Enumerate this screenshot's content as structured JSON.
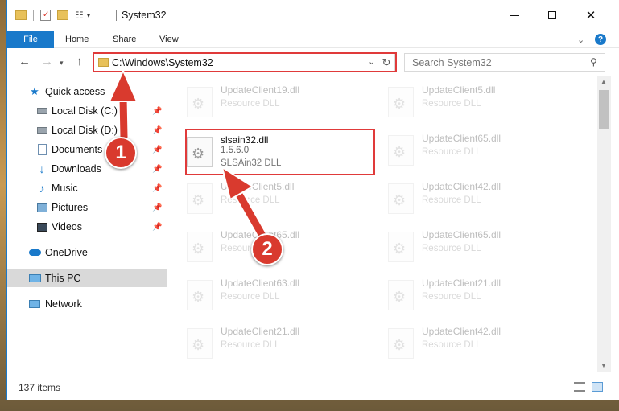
{
  "window": {
    "title": "System32"
  },
  "ribbon": {
    "tabs": [
      "File",
      "Home",
      "Share",
      "View"
    ]
  },
  "address": {
    "path": "C:\\Windows\\System32"
  },
  "search": {
    "placeholder": "Search System32"
  },
  "sidebar": {
    "items": [
      {
        "label": "Quick access",
        "icon": "star-icon",
        "pinned": false
      },
      {
        "label": "Local Disk (C:)",
        "icon": "drive-icon",
        "pinned": true
      },
      {
        "label": "Local Disk (D:)",
        "icon": "drive-icon",
        "pinned": true
      },
      {
        "label": "Documents",
        "icon": "documents-icon",
        "pinned": true
      },
      {
        "label": "Downloads",
        "icon": "download-icon",
        "pinned": true
      },
      {
        "label": "Music",
        "icon": "music-icon",
        "pinned": true
      },
      {
        "label": "Pictures",
        "icon": "pictures-icon",
        "pinned": true
      },
      {
        "label": "Videos",
        "icon": "videos-icon",
        "pinned": true
      },
      {
        "label": "OneDrive",
        "icon": "cloud-icon",
        "pinned": false
      },
      {
        "label": "This PC",
        "icon": "computer-icon",
        "pinned": false,
        "selected": true
      },
      {
        "label": "Network",
        "icon": "network-icon",
        "pinned": false
      }
    ]
  },
  "files": {
    "left": [
      {
        "name": "UpdateClient19.dll",
        "type": "Resource DLL"
      },
      {
        "name": "slsain32.dll",
        "version": "1.5.6.0",
        "description": "SLSAin32 DLL"
      },
      {
        "name": "UpdateClient5.dll",
        "type": "Resource DLL"
      },
      {
        "name": "UpdateClient65.dll",
        "type": "Resource DLL"
      },
      {
        "name": "UpdateClient63.dll",
        "type": "Resource DLL"
      },
      {
        "name": "UpdateClient21.dll",
        "type": "Resource DLL"
      }
    ],
    "right": [
      {
        "name": "UpdateClient5.dll",
        "type": "Resource DLL"
      },
      {
        "name": "UpdateClient65.dll",
        "type": "Resource DLL"
      },
      {
        "name": "UpdateClient42.dll",
        "type": "Resource DLL"
      },
      {
        "name": "UpdateClient65.dll",
        "type": "Resource DLL"
      },
      {
        "name": "UpdateClient21.dll",
        "type": "Resource DLL"
      },
      {
        "name": "UpdateClient42.dll",
        "type": "Resource DLL"
      }
    ]
  },
  "status": {
    "count": "137 items"
  },
  "annotations": {
    "step1": "1",
    "step2": "2"
  },
  "colors": {
    "accent": "#1979ca",
    "highlight": "#e03a3a",
    "badge": "#d93a2e"
  }
}
